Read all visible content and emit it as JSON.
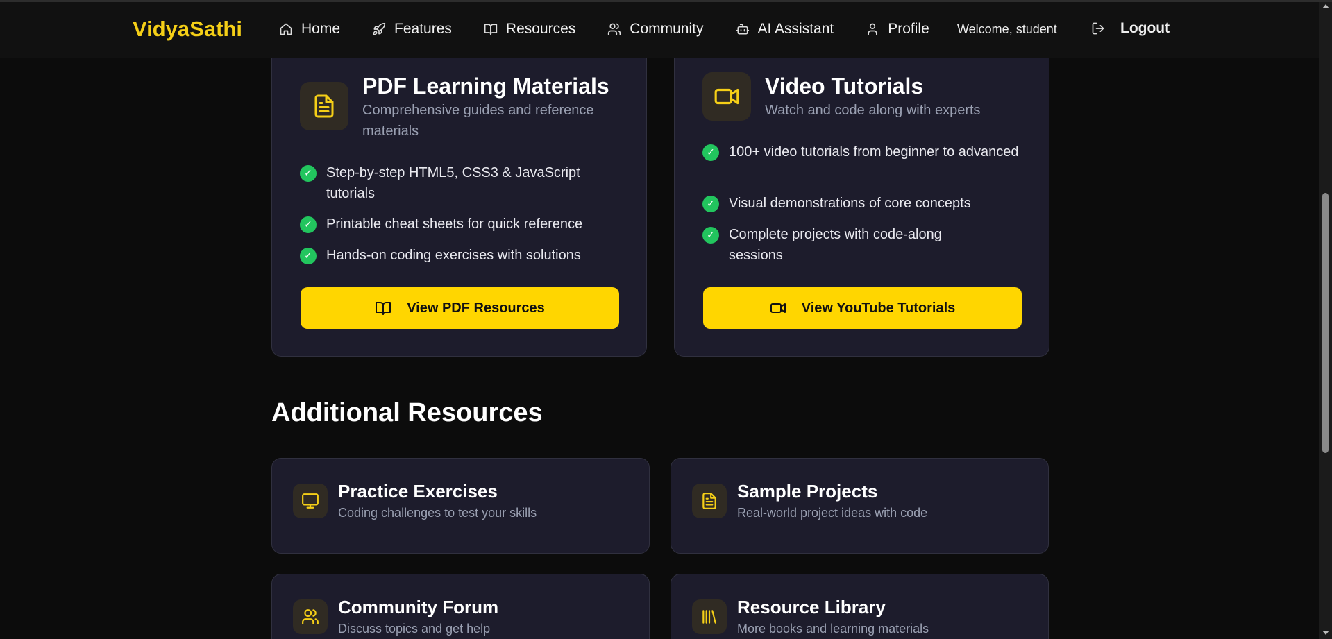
{
  "brand": "VidyaSathi",
  "nav": {
    "links": [
      {
        "label": "Home",
        "icon": "home-icon"
      },
      {
        "label": "Features",
        "icon": "rocket-icon"
      },
      {
        "label": "Resources",
        "icon": "book-open-icon"
      },
      {
        "label": "Community",
        "icon": "users-icon"
      },
      {
        "label": "AI Assistant",
        "icon": "bot-icon"
      },
      {
        "label": "Profile",
        "icon": "user-icon"
      }
    ],
    "welcome": "Welcome, student",
    "logout": "Logout"
  },
  "main_cards": [
    {
      "title": "PDF Learning Materials",
      "subtitle": "Comprehensive guides and reference materials",
      "icon": "file-text-icon",
      "features": [
        "Step-by-step HTML5, CSS3 & JavaScript tutorials",
        "Printable cheat sheets for quick reference",
        "Hands-on coding exercises with solutions"
      ],
      "button": "View PDF Resources",
      "button_icon": "book-open-icon"
    },
    {
      "title": "Video Tutorials",
      "subtitle": "Watch and code along with experts",
      "icon": "video-icon",
      "features": [
        "100+ video tutorials from beginner to advanced",
        "Visual demonstrations of core concepts",
        "Complete projects with code-along sessions"
      ],
      "button": "View YouTube Tutorials",
      "button_icon": "video-icon"
    }
  ],
  "check_glyph": "✓",
  "additional": {
    "title": "Additional Resources",
    "items": [
      {
        "title": "Practice Exercises",
        "subtitle": "Coding challenges to test your skills",
        "icon": "monitor-icon"
      },
      {
        "title": "Sample Projects",
        "subtitle": "Real-world project ideas with code",
        "icon": "file-text-icon"
      },
      {
        "title": "Community Forum",
        "subtitle": "Discuss topics and get help",
        "icon": "users-icon"
      },
      {
        "title": "Resource Library",
        "subtitle": "More books and learning materials",
        "icon": "library-icon"
      }
    ]
  },
  "colors": {
    "accent": "#f5cf17",
    "button": "#ffd600",
    "card_bg": "#1d1c2c",
    "page_bg": "#0c0c0c",
    "check": "#22c55e",
    "muted_text": "#9aa0b2"
  }
}
